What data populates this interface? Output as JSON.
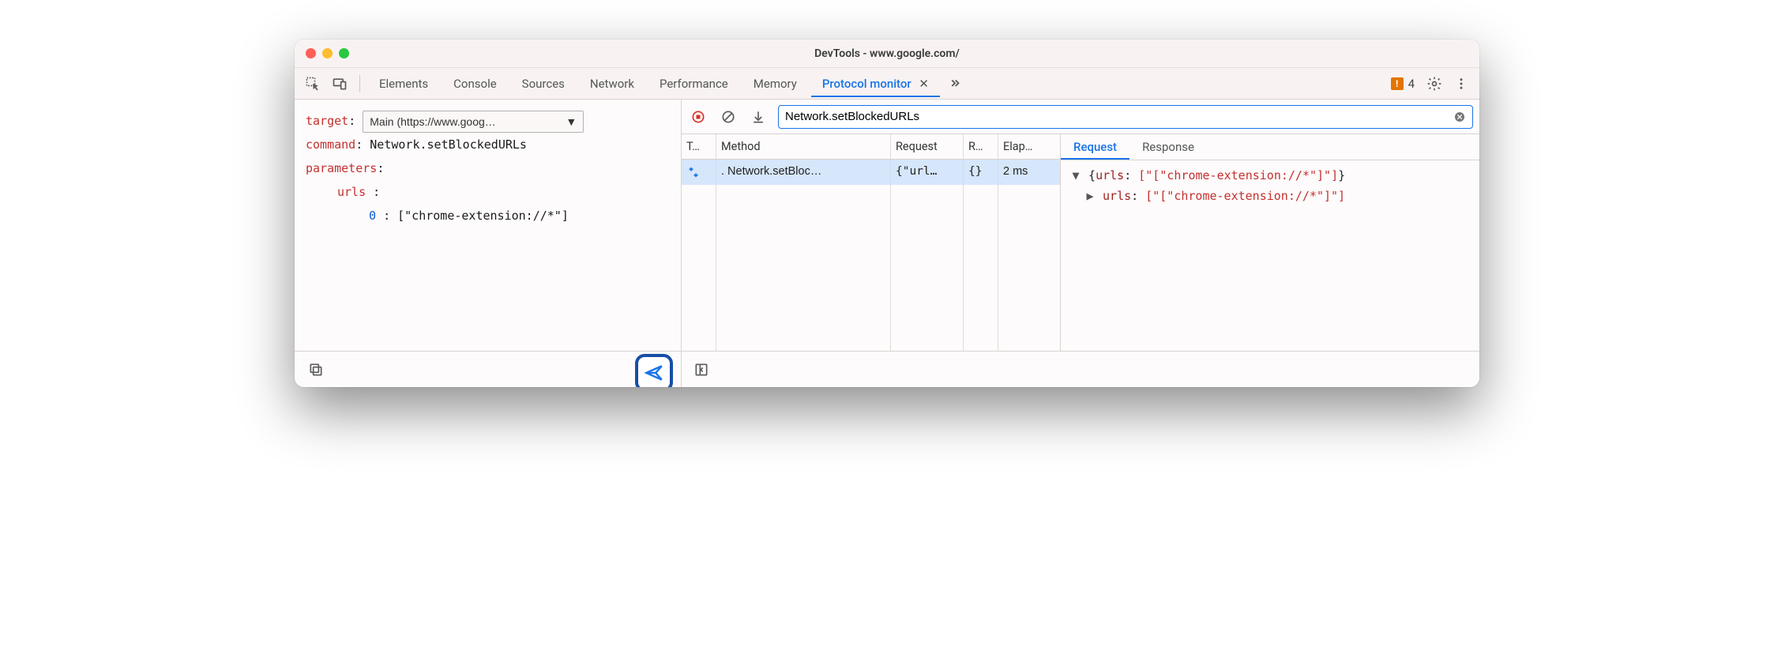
{
  "window": {
    "title": "DevTools - www.google.com/"
  },
  "tabs": {
    "elements": "Elements",
    "console": "Console",
    "sources": "Sources",
    "network": "Network",
    "performance": "Performance",
    "memory": "Memory",
    "protocol_monitor": "Protocol monitor"
  },
  "warnings": {
    "count": "4"
  },
  "editor": {
    "target_label": "target",
    "target_value": "Main (https://www.goog…",
    "command_label": "command",
    "command_value": "Network.setBlockedURLs",
    "parameters_label": "parameters",
    "param_key": "urls",
    "param_index": "0",
    "param_value": "[\"chrome-extension://*\"]"
  },
  "toolbar": {
    "filter_value": "Network.setBlockedURLs"
  },
  "table": {
    "headers": {
      "type": "T…",
      "method": "Method",
      "request": "Request",
      "response": "R…",
      "elapsed": "Elap…"
    },
    "rows": [
      {
        "method": "Network.setBloc…",
        "request": "{\"url…",
        "response": "{}",
        "elapsed": "2 ms"
      }
    ]
  },
  "detail": {
    "tabs": {
      "request": "Request",
      "response": "Response"
    },
    "line1_prefix": "{",
    "line1_key": "urls",
    "line1_value": "[\"[\"chrome-extension://*\"]\"]",
    "line1_suffix": "}",
    "line2_key": "urls",
    "line2_value": "[\"[\"chrome-extension://*\"]\"]"
  }
}
